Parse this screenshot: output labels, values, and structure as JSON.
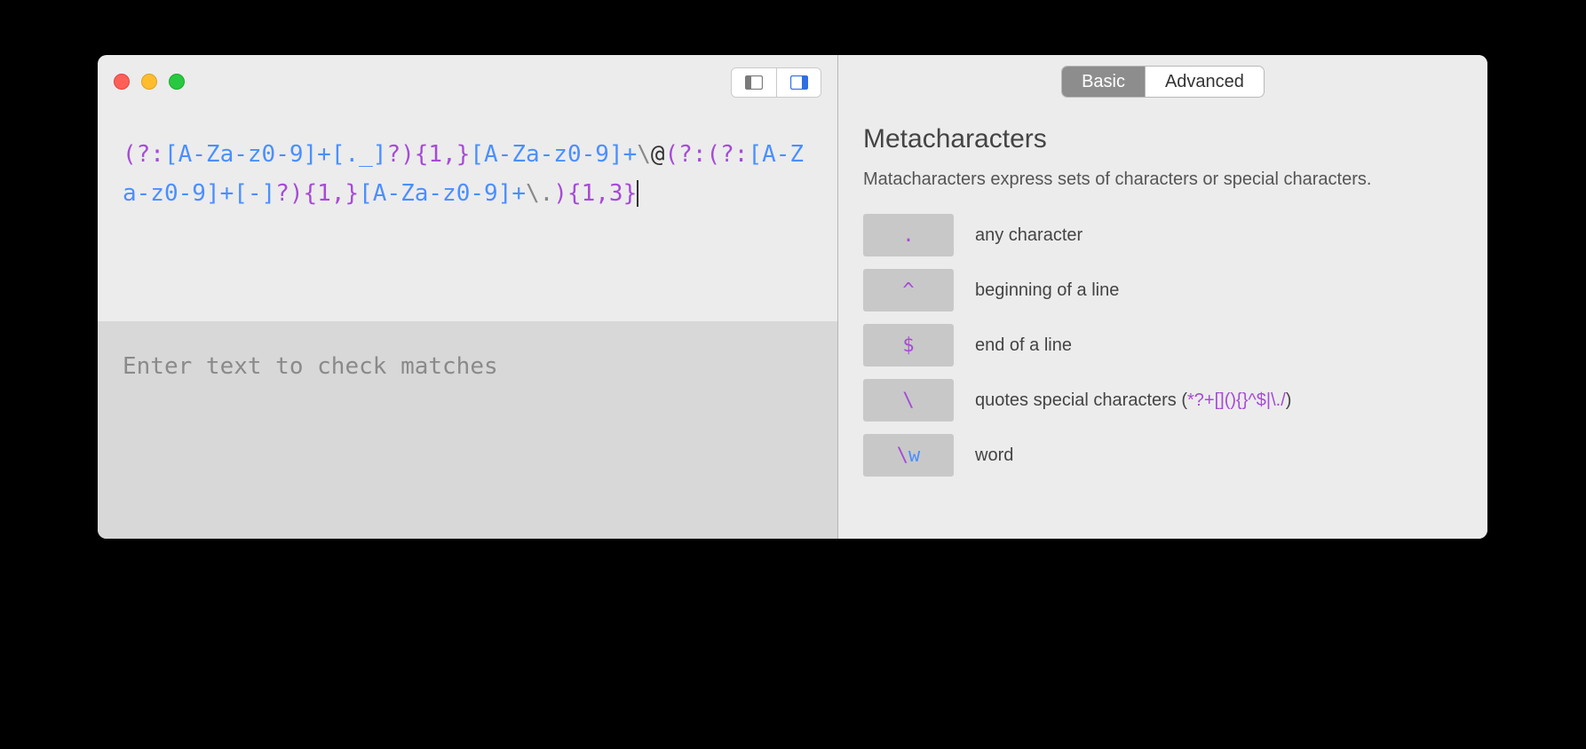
{
  "regex_pattern_tokens": [
    {
      "t": "grp",
      "v": "(?:"
    },
    {
      "t": "chr",
      "v": "[A-Za-z0-9]"
    },
    {
      "t": "chr",
      "v": "+"
    },
    {
      "t": "chr",
      "v": "[._]"
    },
    {
      "t": "grp",
      "v": "?)"
    },
    {
      "t": "grp",
      "v": "{1,}"
    },
    {
      "t": "chr",
      "v": "[A-Za-z0-9]"
    },
    {
      "t": "chr",
      "v": "+"
    },
    {
      "t": "esc",
      "v": "\\"
    },
    {
      "t": "lit",
      "v": "@"
    },
    {
      "t": "grp",
      "v": "(?:"
    },
    {
      "t": "grp",
      "v": "(?:"
    },
    {
      "t": "chr",
      "v": "[A-Za-z0-9]"
    },
    {
      "t": "chr",
      "v": "+"
    },
    {
      "t": "chr",
      "v": "[-]"
    },
    {
      "t": "grp",
      "v": "?)"
    },
    {
      "t": "grp",
      "v": "{1,}"
    },
    {
      "t": "chr",
      "v": "[A-Za-z0-9]"
    },
    {
      "t": "chr",
      "v": "+"
    },
    {
      "t": "esc",
      "v": "\\."
    },
    {
      "t": "grp",
      "v": ")"
    },
    {
      "t": "grp",
      "v": "{1,3"
    },
    {
      "t": "grp",
      "v": "}",
      "cursor": true
    }
  ],
  "match_placeholder": "Enter text to check matches",
  "tabs": {
    "basic": "Basic",
    "advanced": "Advanced",
    "active": "basic"
  },
  "section": {
    "title": "Metacharacters",
    "desc": "Matacharacters express sets of characters or special characters."
  },
  "meta_items": [
    {
      "key_tokens": [
        {
          "c": "grp",
          "v": "."
        }
      ],
      "desc": "any character"
    },
    {
      "key_tokens": [
        {
          "c": "grp",
          "v": "^"
        }
      ],
      "desc": "beginning of a line"
    },
    {
      "key_tokens": [
        {
          "c": "grp",
          "v": "$"
        }
      ],
      "desc": "end of a line"
    },
    {
      "key_tokens": [
        {
          "c": "grp",
          "v": "\\"
        }
      ],
      "desc_prefix": "quotes special characters (",
      "desc_highlight": "*?+[](){}^$|\\./",
      "desc_suffix": ")"
    },
    {
      "key_tokens": [
        {
          "c": "grp",
          "v": "\\"
        },
        {
          "c": "blue",
          "v": "w"
        }
      ],
      "desc": "word"
    }
  ]
}
